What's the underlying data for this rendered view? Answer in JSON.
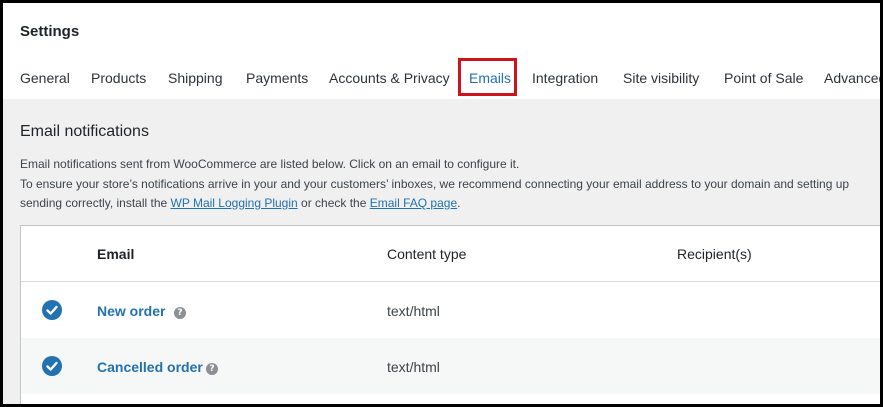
{
  "page": {
    "title": "Settings"
  },
  "tabs": [
    {
      "label": "General",
      "active": false
    },
    {
      "label": "Products",
      "active": false
    },
    {
      "label": "Shipping",
      "active": false
    },
    {
      "label": "Payments",
      "active": false
    },
    {
      "label": "Accounts & Privacy",
      "active": false
    },
    {
      "label": "Emails",
      "active": true
    },
    {
      "label": "Integration",
      "active": false
    },
    {
      "label": "Site visibility",
      "active": false
    },
    {
      "label": "Point of Sale",
      "active": false
    },
    {
      "label": "Advanced",
      "active": false
    }
  ],
  "section": {
    "title": "Email notifications",
    "desc_line1": "Email notifications sent from WooCommerce are listed below. Click on an email to configure it.",
    "desc_line2": "To ensure your store’s notifications arrive in your and your customers’ inboxes, we recommend connecting your email address to your domain and setting up",
    "desc_line3_a": "sending correctly, install the ",
    "desc_link1": "WP Mail Logging Plugin",
    "desc_line3_b": " or check the ",
    "desc_link2": "Email FAQ page",
    "desc_line3_c": "."
  },
  "table": {
    "headers": {
      "email": "Email",
      "content_type": "Content type",
      "recipients": "Recipient(s)"
    },
    "rows": [
      {
        "name": "New order",
        "enabled": true,
        "content_type": "text/html",
        "recipients": ""
      },
      {
        "name": "Cancelled order",
        "enabled": true,
        "content_type": "text/html",
        "recipients": ""
      }
    ]
  },
  "icons": {
    "enabled": "check-circle-icon",
    "help": "help-icon"
  },
  "colors": {
    "accent": "#2271b1",
    "highlight": "#d0121b",
    "background": "#f0f0f1"
  }
}
